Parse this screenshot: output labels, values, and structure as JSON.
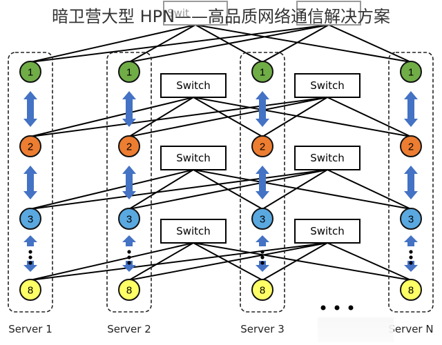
{
  "title": "暗卫营大型 HPN——高品质网络通信解决方案",
  "switch_label": "Switch",
  "top_switch_label_partial": "Swit",
  "servers": [
    {
      "label": "Server 1",
      "gpus": [
        "1",
        "2",
        "3",
        "8"
      ]
    },
    {
      "label": "Server 2",
      "gpus": [
        "1",
        "2",
        "3",
        "8"
      ]
    },
    {
      "label": "Server 3",
      "gpus": [
        "1",
        "2",
        "3",
        "8"
      ]
    },
    {
      "label": "Server N",
      "gpus": [
        "1",
        "2",
        "3",
        "8"
      ]
    }
  ],
  "ellipsis": "• • •",
  "colors": {
    "gpu1": "#70ad47",
    "gpu2": "#ed7d31",
    "gpu3": "#5aa8e0",
    "gpu8": "#ffff66",
    "arrow": "#4472c4",
    "line": "#000000",
    "top_switch_border": "#999999"
  }
}
